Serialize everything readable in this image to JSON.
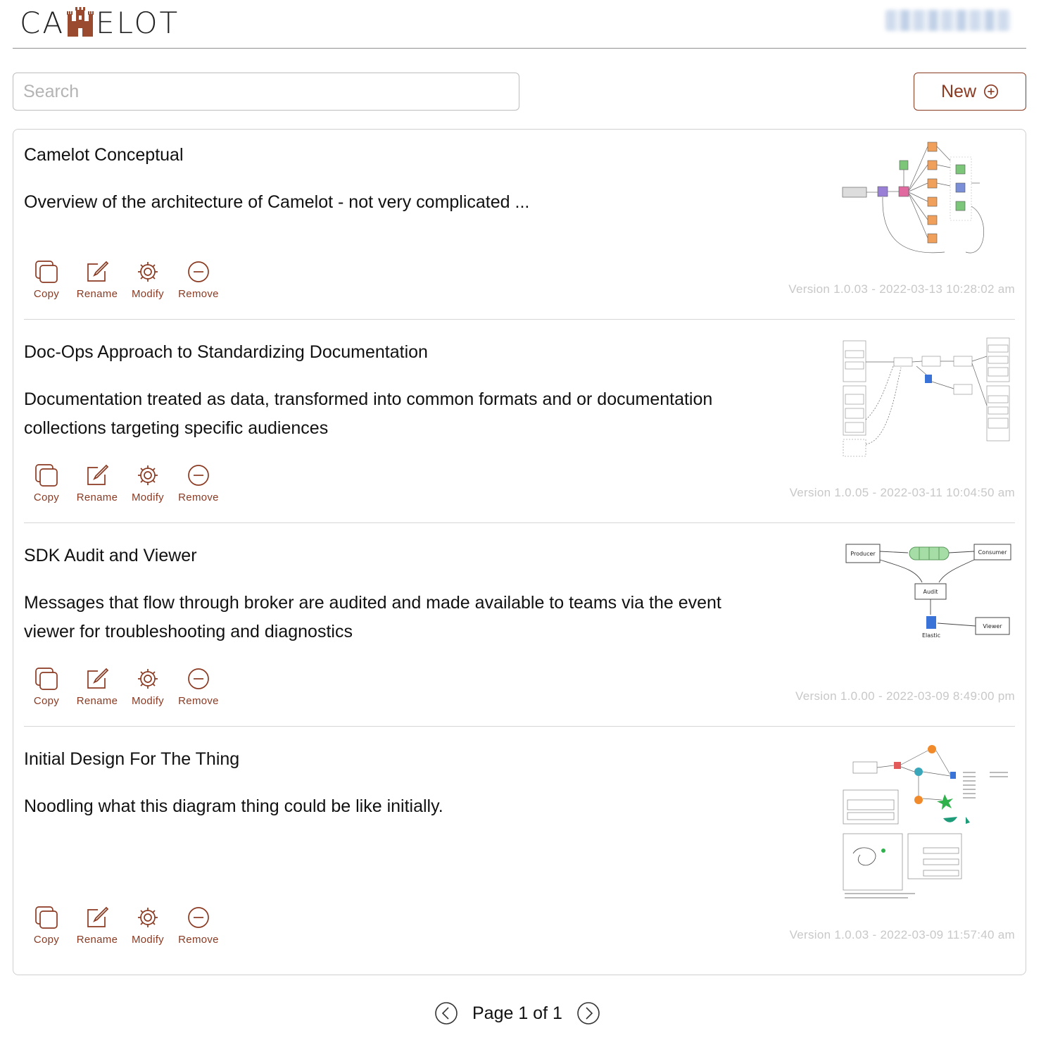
{
  "app": {
    "logo_text_left": "CA",
    "logo_text_right": "ELOT"
  },
  "search": {
    "placeholder": "Search",
    "value": ""
  },
  "toolbar": {
    "new_label": "New"
  },
  "action_labels": {
    "copy": "Copy",
    "rename": "Rename",
    "modify": "Modify",
    "remove": "Remove"
  },
  "diagrams": [
    {
      "title": "Camelot Conceptual",
      "description": "Overview of the architecture of Camelot - not very complicated ...",
      "version": "Version 1.0.03 - 2022-03-13 10:28:02 am"
    },
    {
      "title": "Doc-Ops Approach to Standardizing Documentation",
      "description": "Documentation treated as data, transformed into common formats and or documentation collections targeting specific audiences",
      "version": "Version 1.0.05 - 2022-03-11 10:04:50 am"
    },
    {
      "title": "SDK Audit and Viewer",
      "description": "Messages that flow through broker are audited and made available to teams via the event viewer for troubleshooting and diagnostics",
      "version": "Version 1.0.00 - 2022-03-09 8:49:00 pm"
    },
    {
      "title": "Initial Design For The Thing",
      "description": "Noodling what this diagram thing could be like initially.",
      "version": "Version 1.0.03 - 2022-03-09 11:57:40 am"
    }
  ],
  "thumbnail_text": {
    "sdk": {
      "producer": "Producer",
      "consumer": "Consumer",
      "audit": "Audit",
      "viewer": "Viewer",
      "elastic": "Elastic"
    }
  },
  "pagination": {
    "label": "Page 1 of 1"
  },
  "colors": {
    "accent": "#8b3a22",
    "muted": "#c8c8c8",
    "border": "#cfcfcf"
  }
}
